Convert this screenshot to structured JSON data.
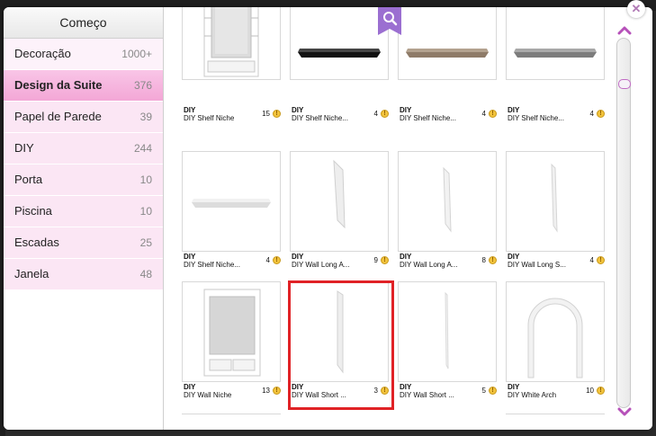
{
  "sidebar": {
    "header": "Começo",
    "items": [
      {
        "label": "Decoração",
        "count": "1000+"
      },
      {
        "label": "Design da Suite",
        "count": "376"
      },
      {
        "label": "Papel de Parede",
        "count": "39"
      },
      {
        "label": "DIY",
        "count": "244"
      },
      {
        "label": "Porta",
        "count": "10"
      },
      {
        "label": "Piscina",
        "count": "10"
      },
      {
        "label": "Escadas",
        "count": "25"
      },
      {
        "label": "Janela",
        "count": "48"
      }
    ]
  },
  "items": [
    {
      "brand": "DIY",
      "name": "DIY Shelf Niche",
      "count": "15",
      "icon": "shelf-niche"
    },
    {
      "brand": "DIY",
      "name": "DIY Shelf Niche...",
      "count": "4",
      "icon": "shelf-black"
    },
    {
      "brand": "DIY",
      "name": "DIY Shelf Niche...",
      "count": "4",
      "icon": "shelf-brown"
    },
    {
      "brand": "DIY",
      "name": "DIY Shelf Niche...",
      "count": "4",
      "icon": "shelf-gray"
    },
    {
      "brand": "DIY",
      "name": "DIY Shelf Niche...",
      "count": "4",
      "icon": "shelf-white"
    },
    {
      "brand": "DIY",
      "name": "DIY Wall Long A...",
      "count": "9",
      "icon": "wall-long-a"
    },
    {
      "brand": "DIY",
      "name": "DIY Wall Long A...",
      "count": "8",
      "icon": "wall-long-a2"
    },
    {
      "brand": "DIY",
      "name": "DIY Wall Long S...",
      "count": "4",
      "icon": "wall-long-s"
    },
    {
      "brand": "DIY",
      "name": "DIY Wall Niche",
      "count": "13",
      "icon": "wall-niche"
    },
    {
      "brand": "DIY",
      "name": "DIY Wall Short ...",
      "count": "3",
      "icon": "wall-short"
    },
    {
      "brand": "DIY",
      "name": "DIY Wall Short ...",
      "count": "5",
      "icon": "wall-short-2"
    },
    {
      "brand": "DIY",
      "name": "DIY White Arch",
      "count": "10",
      "icon": "white-arch"
    }
  ],
  "coin_symbol": "!",
  "colors": {
    "selected": "#f3a7d6",
    "highlight": "#e02226",
    "accent": "#b07ab5"
  }
}
